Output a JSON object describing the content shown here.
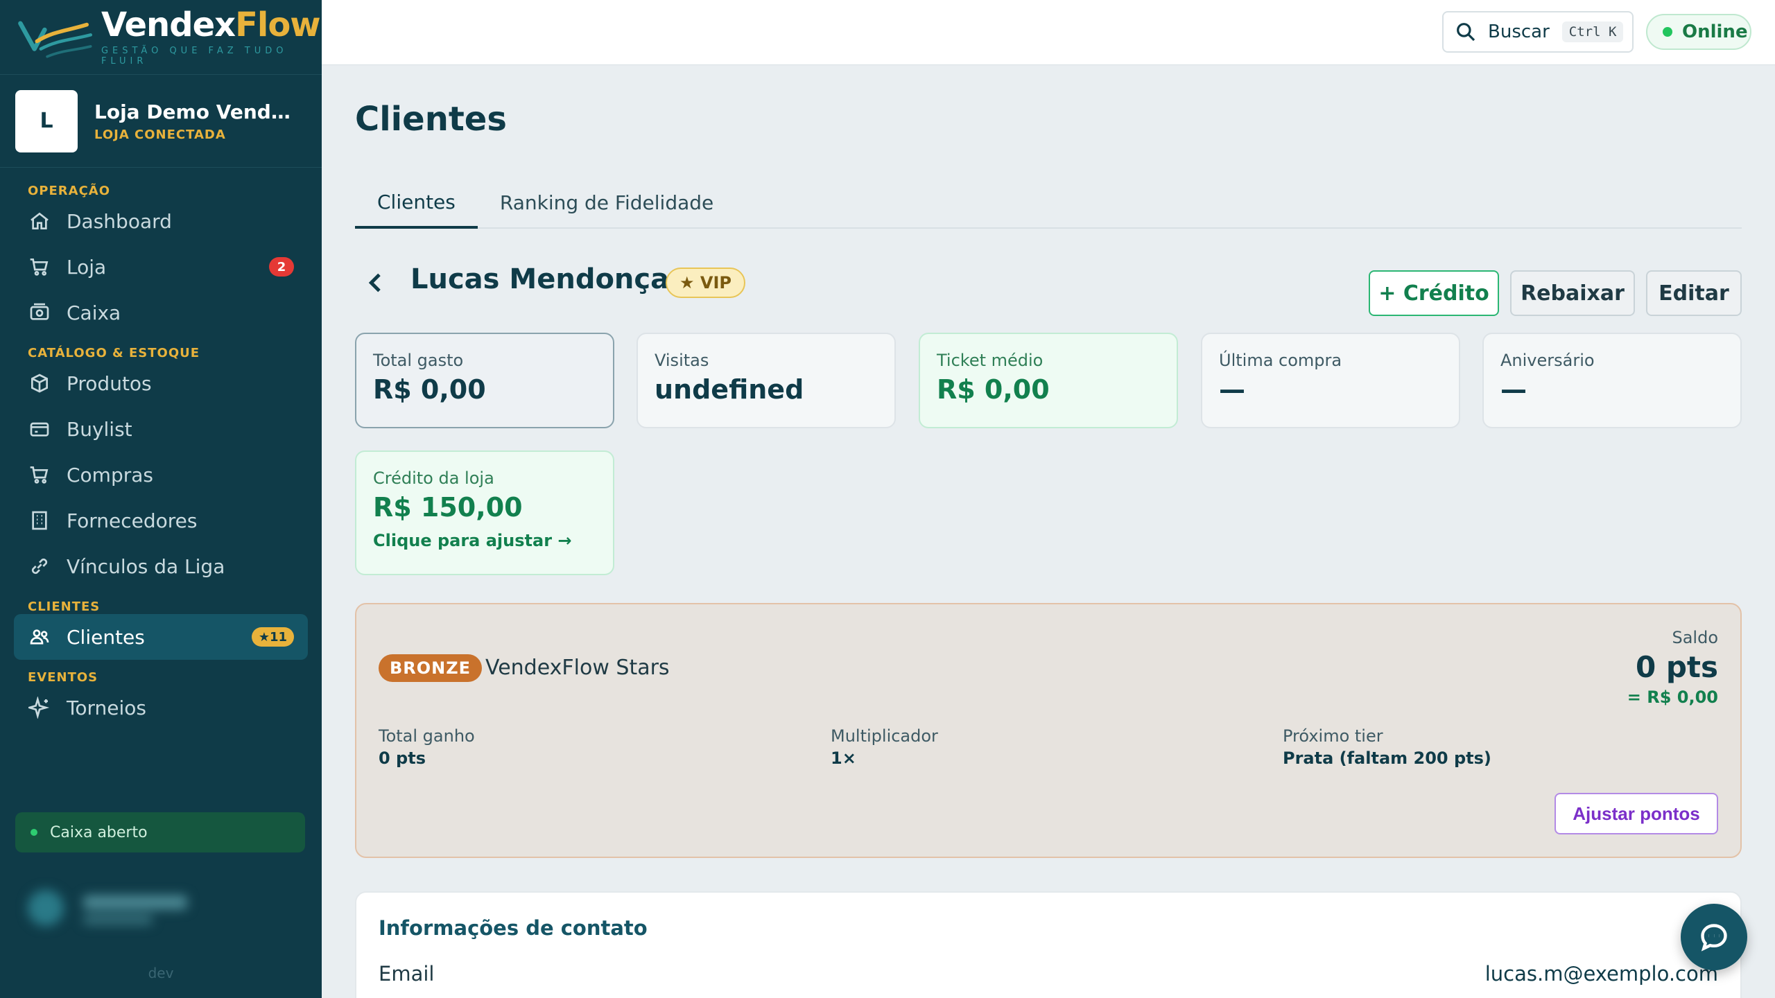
{
  "brand": {
    "name_part1": "Vendex",
    "name_part2": "Flow",
    "tagline": "GESTÃO QUE FAZ TUDO FLUIR"
  },
  "store": {
    "initial": "L",
    "name": "Loja Demo VendexFlow",
    "status": "LOJA CONECTADA"
  },
  "nav": {
    "sections": [
      {
        "title": "OPERAÇÃO",
        "items": [
          {
            "label": "Dashboard",
            "icon": "home-icon"
          },
          {
            "label": "Loja",
            "icon": "cart-icon",
            "badge": "2"
          },
          {
            "label": "Caixa",
            "icon": "cash-register-icon"
          }
        ]
      },
      {
        "title": "CATÁLOGO & ESTOQUE",
        "items": [
          {
            "label": "Produtos",
            "icon": "box-icon"
          },
          {
            "label": "Buylist",
            "icon": "card-icon"
          },
          {
            "label": "Compras",
            "icon": "cart-icon"
          },
          {
            "label": "Fornecedores",
            "icon": "building-icon"
          },
          {
            "label": "Vínculos da Liga",
            "icon": "link-icon"
          }
        ]
      },
      {
        "title": "CLIENTES",
        "items": [
          {
            "label": "Clientes",
            "icon": "users-icon",
            "badge": "★11",
            "active": true
          }
        ]
      },
      {
        "title": "EVENTOS",
        "items": [
          {
            "label": "Torneios",
            "icon": "sparkle-icon"
          }
        ]
      }
    ]
  },
  "cash_status": "Caixa aberto",
  "env_label": "dev",
  "topbar": {
    "search_label": "Buscar",
    "search_shortcut": "Ctrl K",
    "online_label": "Online"
  },
  "page": {
    "title": "Clientes",
    "tabs": [
      {
        "label": "Clientes",
        "active": true
      },
      {
        "label": "Ranking de Fidelidade",
        "active": false
      }
    ]
  },
  "client": {
    "name": "Lucas Mendonça",
    "vip_label": "★ VIP",
    "actions": {
      "credit": "+ Crédito",
      "downgrade": "Rebaixar",
      "edit": "Editar"
    }
  },
  "stats": [
    {
      "label": "Total gasto",
      "value": "R$ 0,00"
    },
    {
      "label": "Visitas",
      "value": "undefined"
    },
    {
      "label": "Ticket médio",
      "value": "R$ 0,00"
    },
    {
      "label": "Última compra",
      "value": "—"
    },
    {
      "label": "Aniversário",
      "value": "—"
    }
  ],
  "store_credit": {
    "label": "Crédito da loja",
    "value": "R$ 150,00",
    "action": "Clique para ajustar →"
  },
  "loyalty": {
    "tier": "BRONZE",
    "program": "VendexFlow Stars",
    "balance_label": "Saldo",
    "balance_value": "0 pts",
    "balance_money": "= R$ 0,00",
    "total_label": "Total ganho",
    "total_value": "0 pts",
    "multiplier_label": "Multiplicador",
    "multiplier_value": "1×",
    "next_label": "Próximo tier",
    "next_value": "Prata (faltam 200 pts)",
    "adjust_button": "Ajustar pontos"
  },
  "contact": {
    "title": "Informações de contato",
    "email_label": "Email",
    "email_value": "lucas.m@exemplo.com"
  },
  "colors": {
    "sidebar": "#0f3b48",
    "accent_gold": "#e8b23b",
    "accent_green": "#12804e",
    "tier_bronze": "#c9722c",
    "adjust_purple": "#7b2fc9"
  }
}
